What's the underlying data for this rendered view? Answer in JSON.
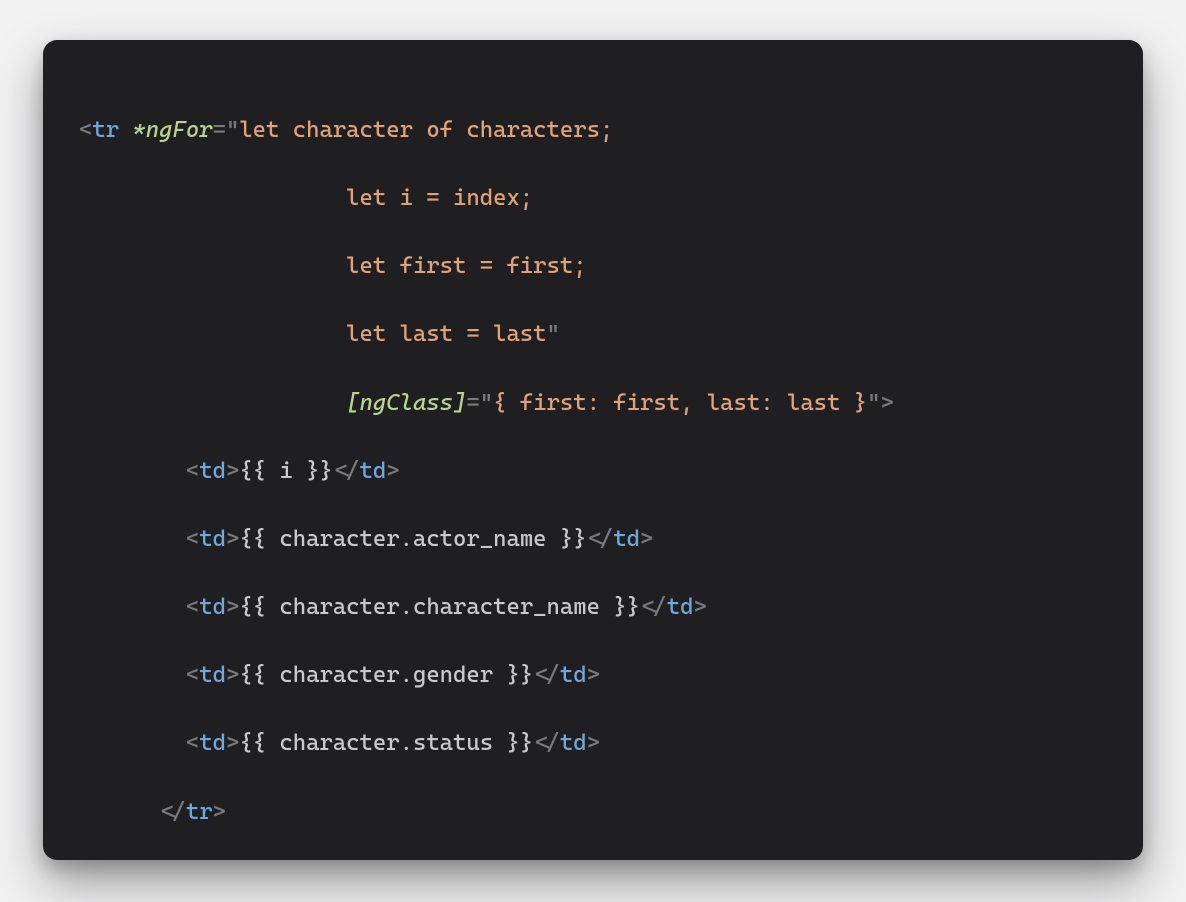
{
  "code": {
    "lines": [
      [
        {
          "t": "<",
          "c": "punct"
        },
        {
          "t": "tr",
          "c": "tag"
        },
        {
          "t": " "
        },
        {
          "t": "*ngFor",
          "c": "attr-it"
        },
        {
          "t": "=",
          "c": "punct"
        },
        {
          "t": "\"",
          "c": "punct"
        },
        {
          "t": "let character of characters;",
          "c": "str"
        }
      ],
      [
        {
          "t": "                    ",
          "c": "str"
        },
        {
          "t": "let i = index;",
          "c": "str"
        }
      ],
      [
        {
          "t": "                    ",
          "c": "str"
        },
        {
          "t": "let first = first;",
          "c": "str"
        }
      ],
      [
        {
          "t": "                    ",
          "c": "str"
        },
        {
          "t": "let last = last",
          "c": "str"
        },
        {
          "t": "\"",
          "c": "punct"
        }
      ],
      [
        {
          "t": "                    "
        },
        {
          "t": "[ngClass]",
          "c": "attr-it"
        },
        {
          "t": "=",
          "c": "punct"
        },
        {
          "t": "\"",
          "c": "punct"
        },
        {
          "t": "{ first: first, last: last }",
          "c": "str"
        },
        {
          "t": "\"",
          "c": "punct"
        },
        {
          "t": ">",
          "c": "punct"
        }
      ],
      [
        {
          "t": "        "
        },
        {
          "t": "<",
          "c": "punct"
        },
        {
          "t": "td",
          "c": "tag"
        },
        {
          "t": ">",
          "c": "punct"
        },
        {
          "t": "{{ i }}",
          "c": "expr"
        },
        {
          "t": "<",
          "c": "punct"
        },
        {
          "t": "/",
          "c": "punct"
        },
        {
          "t": "td",
          "c": "tag"
        },
        {
          "t": ">",
          "c": "punct"
        }
      ],
      [
        {
          "t": "        "
        },
        {
          "t": "<",
          "c": "punct"
        },
        {
          "t": "td",
          "c": "tag"
        },
        {
          "t": ">",
          "c": "punct"
        },
        {
          "t": "{{ character.actor_name }}",
          "c": "expr"
        },
        {
          "t": "<",
          "c": "punct"
        },
        {
          "t": "/",
          "c": "punct"
        },
        {
          "t": "td",
          "c": "tag"
        },
        {
          "t": ">",
          "c": "punct"
        }
      ],
      [
        {
          "t": "        "
        },
        {
          "t": "<",
          "c": "punct"
        },
        {
          "t": "td",
          "c": "tag"
        },
        {
          "t": ">",
          "c": "punct"
        },
        {
          "t": "{{ character.character_name }}",
          "c": "expr"
        },
        {
          "t": "<",
          "c": "punct"
        },
        {
          "t": "/",
          "c": "punct"
        },
        {
          "t": "td",
          "c": "tag"
        },
        {
          "t": ">",
          "c": "punct"
        }
      ],
      [
        {
          "t": "        "
        },
        {
          "t": "<",
          "c": "punct"
        },
        {
          "t": "td",
          "c": "tag"
        },
        {
          "t": ">",
          "c": "punct"
        },
        {
          "t": "{{ character.gender }}",
          "c": "expr"
        },
        {
          "t": "<",
          "c": "punct"
        },
        {
          "t": "/",
          "c": "punct"
        },
        {
          "t": "td",
          "c": "tag"
        },
        {
          "t": ">",
          "c": "punct"
        }
      ],
      [
        {
          "t": "        "
        },
        {
          "t": "<",
          "c": "punct"
        },
        {
          "t": "td",
          "c": "tag"
        },
        {
          "t": ">",
          "c": "punct"
        },
        {
          "t": "{{ character.status }}",
          "c": "expr"
        },
        {
          "t": "<",
          "c": "punct"
        },
        {
          "t": "/",
          "c": "punct"
        },
        {
          "t": "td",
          "c": "tag"
        },
        {
          "t": ">",
          "c": "punct"
        }
      ],
      [
        {
          "t": "      "
        },
        {
          "t": "<",
          "c": "punct"
        },
        {
          "t": "/",
          "c": "punct"
        },
        {
          "t": "tr",
          "c": "tag"
        },
        {
          "t": ">",
          "c": "punct"
        }
      ]
    ]
  }
}
